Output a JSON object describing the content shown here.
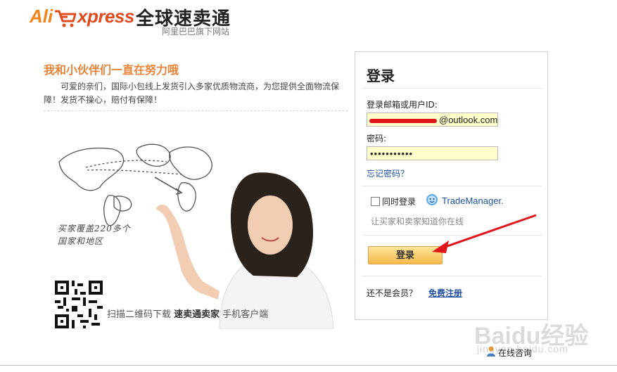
{
  "header": {
    "logo_ali": "Ali",
    "logo_xpress": "xpress",
    "logo_cn": "全球速卖通",
    "logo_sub": "阿里巴巴旗下网站"
  },
  "promo": {
    "title": "我和小伙伴们一直在努力哦",
    "text": "可爱的亲们，国际小包线上发货引入多家优质物流商，为您提供全面物流保障！发货不操心，赔付有保障！",
    "map_note_line1": "买家覆盖220多个",
    "map_note_line2": "国家和地区",
    "qr_prefix": "扫描二维码下载 ",
    "qr_app": "速卖通卖家",
    "qr_suffix": " 手机客户端"
  },
  "login": {
    "title": "登录",
    "email_label": "登录邮箱或用户ID:",
    "email_visible": "@outlook.com",
    "password_label": "密码:",
    "password_value": "•••••••••••",
    "forgot": "忘记密码？",
    "simultaneous": "同时登录",
    "trademanager": "TradeManager.",
    "hint": "让买家和卖家知道你在线",
    "submit": "登录",
    "not_member": "还不是会员？",
    "register": "免费注册"
  },
  "footer": {
    "watermark": "Baidu经验",
    "watermark_url": "jingyan.baidu.com",
    "online_consult": "在线咨询"
  },
  "colors": {
    "accent_orange": "#e8833a",
    "link_blue": "#1f4f9e",
    "field_yellow": "#ffffcc",
    "annotation_red": "#e0141b"
  }
}
